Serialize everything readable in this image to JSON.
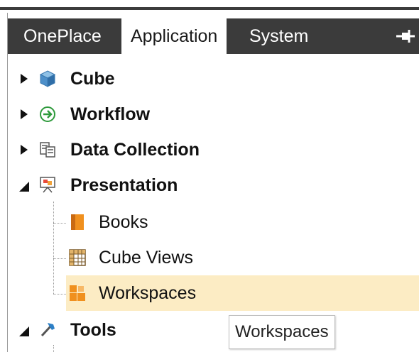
{
  "tabs": [
    {
      "label": "OnePlace",
      "active": false
    },
    {
      "label": "Application",
      "active": true
    },
    {
      "label": "System",
      "active": false
    }
  ],
  "tree": {
    "items": [
      {
        "label": "Cube",
        "icon": "cube-icon",
        "expanded": false,
        "bold": true
      },
      {
        "label": "Workflow",
        "icon": "workflow-icon",
        "expanded": false,
        "bold": true
      },
      {
        "label": "Data Collection",
        "icon": "data-collection-icon",
        "expanded": false,
        "bold": true
      },
      {
        "label": "Presentation",
        "icon": "presentation-icon",
        "expanded": true,
        "bold": true,
        "children": [
          {
            "label": "Books",
            "icon": "book-icon"
          },
          {
            "label": "Cube Views",
            "icon": "grid-icon"
          },
          {
            "label": "Workspaces",
            "icon": "workspaces-icon",
            "selected": true
          }
        ]
      },
      {
        "label": "Tools",
        "icon": "hammer-icon",
        "expanded": true,
        "bold": true
      }
    ]
  },
  "tooltip": {
    "text": "Workspaces"
  },
  "colors": {
    "tabbar_bg": "#3b3b3b",
    "selection_bg": "#fcecc4",
    "accent_orange": "#f0901e"
  }
}
